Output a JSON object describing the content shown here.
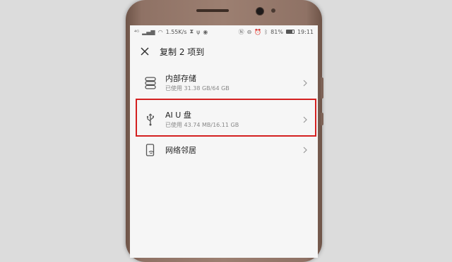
{
  "status_bar": {
    "signal": "⁴ᴳ",
    "speed": "1.55K/s",
    "battery": "81%",
    "battery_level": 0.81,
    "time": "19:11"
  },
  "header": {
    "title": "复制 2 项到"
  },
  "locations": [
    {
      "icon": "internal-storage-icon",
      "title": "内部存储",
      "subtitle": "已使用 31.38 GB/64 GB"
    },
    {
      "icon": "usb-icon",
      "title": "AI U 盘",
      "subtitle": "已使用 43.74 MB/16.11 GB"
    },
    {
      "icon": "network-neighborhood-icon",
      "title": "网络邻居"
    }
  ],
  "colors": {
    "highlight": "#d42020",
    "phone_body": "#9c7f71",
    "screen_bg": "#f6f6f6"
  }
}
